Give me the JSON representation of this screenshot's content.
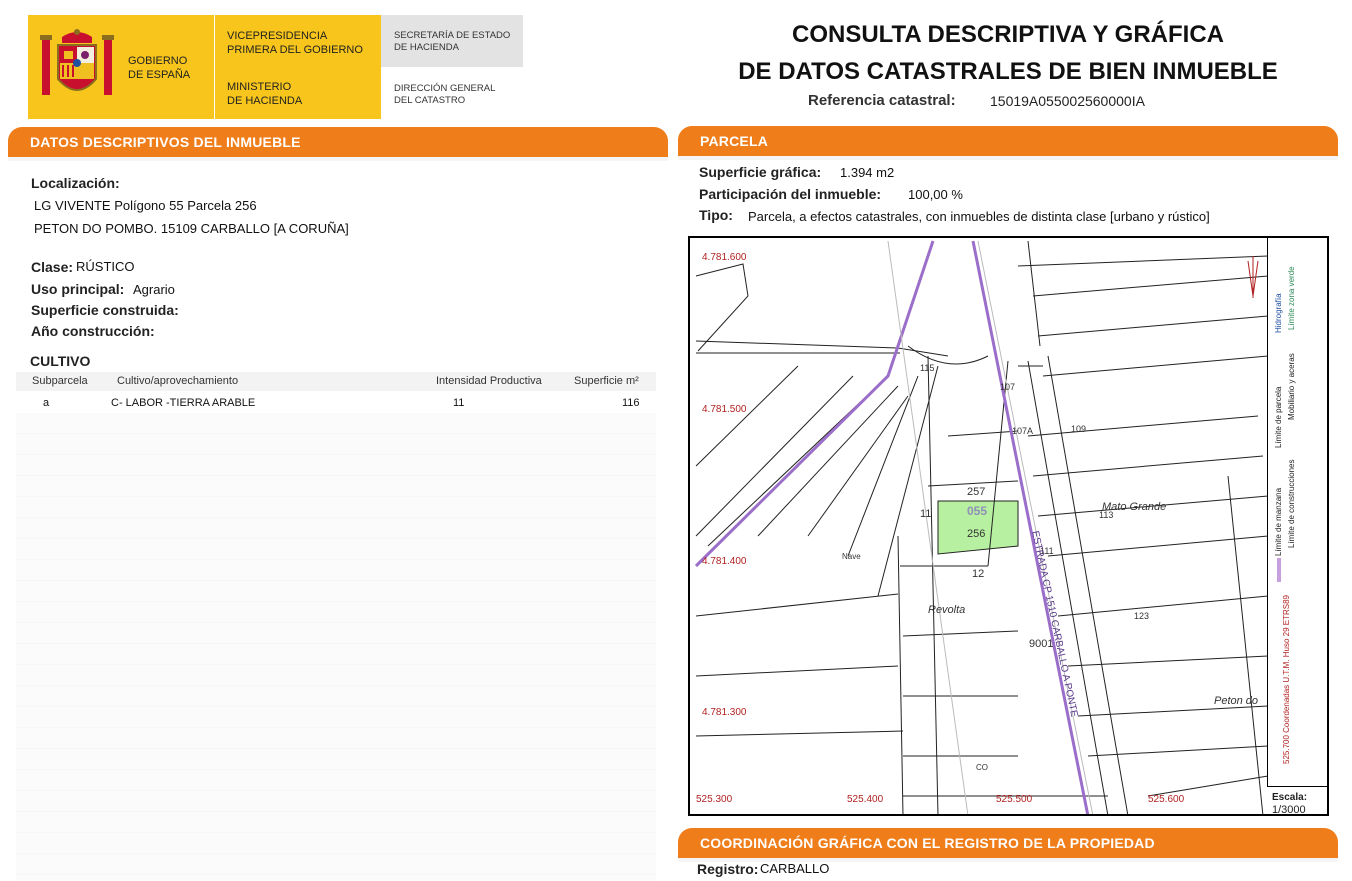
{
  "header": {
    "gov_line1": "GOBIERNO",
    "gov_line2": "DE ESPAÑA",
    "vp_line1": "VICEPRESIDENCIA",
    "vp_line2": "PRIMERA DEL GOBIERNO",
    "min_line1": "MINISTERIO",
    "min_line2": "DE HACIENDA",
    "sec_line1": "SECRETARÍA DE ESTADO",
    "sec_line2": "DE HACIENDA",
    "dir_line1": "DIRECCIÓN GENERAL",
    "dir_line2": "DEL CATASTRO",
    "title_line1": "CONSULTA DESCRIPTIVA Y GRÁFICA",
    "title_line2": "DE DATOS CATASTRALES DE BIEN INMUEBLE",
    "ref_label": "Referencia catastral:",
    "ref_value": "15019A055002560000IA"
  },
  "descriptivos": {
    "section_title": "DATOS DESCRIPTIVOS DEL INMUEBLE",
    "localizacion_label": "Localización:",
    "localizacion_line1": "LG VIVENTE  Polígono 55 Parcela 256",
    "localizacion_line2": "PETON DO POMBO. 15109 CARBALLO [A CORUÑA]",
    "clase_label": "Clase:",
    "clase_value": "RÚSTICO",
    "uso_label": "Uso principal:",
    "uso_value": "Agrario",
    "superficie_label": "Superficie construida:",
    "ano_label": "Año construcción:",
    "cultivo_title": "CULTIVO",
    "columns": [
      "Subparcela",
      "Cultivo/aprovechamiento",
      "Intensidad Productiva",
      "Superficie m²"
    ],
    "rows": [
      {
        "subparcela": "a",
        "cultivo": "C- LABOR -TIERRA ARABLE",
        "intensidad": "11",
        "superficie": "116"
      }
    ]
  },
  "parcela": {
    "section_title": "PARCELA",
    "sup_label": "Superficie gráfica:",
    "sup_value": "1.394 m2",
    "part_label": "Participación del inmueble:",
    "part_value": "100,00 %",
    "tipo_label": "Tipo:",
    "tipo_value": "Parcela, a efectos catastrales, con inmuebles de distinta clase [urbano y rústico]"
  },
  "map": {
    "y_coords": [
      "4.781.600",
      "4.781.500",
      "4.781.400",
      "4.781.300"
    ],
    "x_coords": [
      "525.300",
      "525.400",
      "525.500",
      "525.600"
    ],
    "parcel_labels": [
      "257",
      "055",
      "256",
      "11",
      "12",
      "9001",
      "113",
      "107",
      "107A",
      "109",
      "115",
      "111",
      "123"
    ],
    "place_names": [
      "Mato Grande",
      "Revolta",
      "Peton do",
      "Nave",
      "CO"
    ],
    "road_label": "ESTRADA CP 1510 CARBALLO A PONTE",
    "legend": {
      "hidrografia": "Hidrografía",
      "zona_verde": "Límite zona verde",
      "parcela": "Límite de parcela",
      "mobiliario": "Mobiliario y aceras",
      "manzana": "Límite de manzana",
      "construcciones": "Límite de construcciones",
      "coordenadas": "525.700 Coordenadas U.T.M. Huso 29 ETRS89"
    },
    "scale_label": "Escala:",
    "scale_value": "1/3000",
    "colors": {
      "highlight": "#b7f0a0",
      "road": "#9b6fc9",
      "coord_text": "#b22222"
    }
  },
  "coordinacion": {
    "section_title": "COORDINACIÓN GRÁFICA CON EL REGISTRO DE LA PROPIEDAD",
    "registro_label": "Registro:",
    "registro_value": "CARBALLO"
  }
}
